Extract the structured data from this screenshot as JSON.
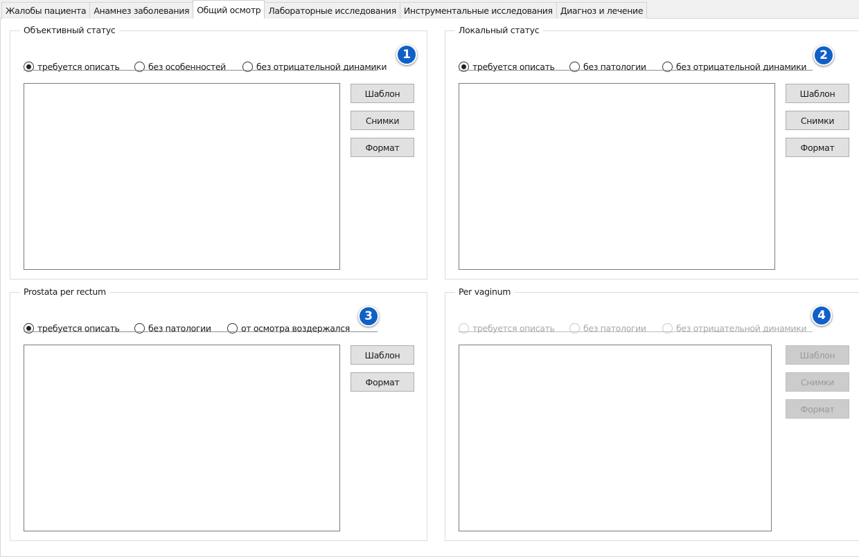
{
  "tabs": [
    {
      "label": "Жалобы пациента",
      "active": false
    },
    {
      "label": "Анамнез заболевания",
      "active": false
    },
    {
      "label": "Общий осмотр",
      "active": true
    },
    {
      "label": "Лабораторные исследования",
      "active": false
    },
    {
      "label": "Инструментальные исследования",
      "active": false
    },
    {
      "label": "Диагноз и лечение",
      "active": false
    }
  ],
  "colors": {
    "badge": "#1160c8",
    "disabled_text": "#a8a8a8"
  },
  "groups": {
    "objective": {
      "title": "Объективный статус",
      "badge": "1",
      "options": [
        {
          "label": "требуется описать",
          "checked": true
        },
        {
          "label": "без особенностей",
          "checked": false
        },
        {
          "label": "без отрицательной динамики",
          "checked": false
        }
      ],
      "text_value": "",
      "buttons": [
        {
          "label": "Шаблон"
        },
        {
          "label": "Снимки"
        },
        {
          "label": "Формат"
        }
      ],
      "enabled": true
    },
    "local": {
      "title": "Локальный статус",
      "badge": "2",
      "options": [
        {
          "label": "требуется описать",
          "checked": true
        },
        {
          "label": "без патологии",
          "checked": false
        },
        {
          "label": "без отрицательной динамики",
          "checked": false
        }
      ],
      "text_value": "",
      "buttons": [
        {
          "label": "Шаблон"
        },
        {
          "label": "Снимки"
        },
        {
          "label": "Формат"
        }
      ],
      "enabled": true
    },
    "prostata": {
      "title": "Prostata per rectum",
      "badge": "3",
      "options": [
        {
          "label": "требуется описать",
          "checked": true
        },
        {
          "label": "без патологии",
          "checked": false
        },
        {
          "label": "от осмотра воздержался",
          "checked": false
        }
      ],
      "text_value": "",
      "buttons": [
        {
          "label": "Шаблон"
        },
        {
          "label": "Формат"
        }
      ],
      "enabled": true
    },
    "vaginum": {
      "title": "Per vaginum",
      "badge": "4",
      "options": [
        {
          "label": "требуется описать",
          "checked": false
        },
        {
          "label": "без патологии",
          "checked": false
        },
        {
          "label": "без отрицательной динамики",
          "checked": false
        }
      ],
      "text_value": "",
      "buttons": [
        {
          "label": "Шаблон"
        },
        {
          "label": "Снимки"
        },
        {
          "label": "Формат"
        }
      ],
      "enabled": false
    }
  }
}
